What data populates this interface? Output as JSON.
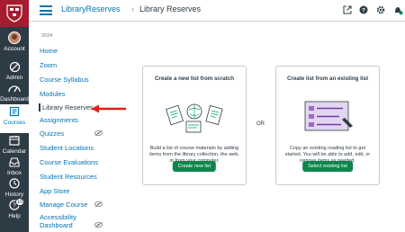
{
  "global_nav": {
    "items": [
      {
        "label": "Account",
        "icon": "avatar"
      },
      {
        "label": "Admin",
        "icon": "shield-icon"
      },
      {
        "label": "Dashboard",
        "icon": "dashboard-icon"
      },
      {
        "label": "Courses",
        "icon": "book-icon"
      },
      {
        "label": "Calendar",
        "icon": "calendar-icon"
      },
      {
        "label": "Inbox",
        "icon": "inbox-icon"
      },
      {
        "label": "History",
        "icon": "clock-icon"
      },
      {
        "label": "Help",
        "icon": "help-icon",
        "badge": "10"
      }
    ]
  },
  "header": {
    "breadcrumb_course": "LibraryReserves",
    "breadcrumb_separator": "›",
    "breadcrumb_page": "Library Reserves"
  },
  "course_nav": {
    "term": "2024",
    "items": [
      {
        "label": "Home"
      },
      {
        "label": "Zoom"
      },
      {
        "label": "Course Syllabus"
      },
      {
        "label": "Modules"
      },
      {
        "label": "Library Reserves"
      },
      {
        "label": "Assignments"
      },
      {
        "label": "Quizzes"
      },
      {
        "label": "Student Locations"
      },
      {
        "label": "Course Evaluations"
      },
      {
        "label": "Student Resources"
      },
      {
        "label": "App Store"
      },
      {
        "label": "Manage Course"
      },
      {
        "label": "Accessibility Dashboard"
      }
    ]
  },
  "main": {
    "card_new": {
      "title": "Create a new list from scratch",
      "description": "Build a list of course materials by adding items from the library collection, the web, or from your computer.",
      "button": "Create new list"
    },
    "or_label": "OR",
    "card_existing": {
      "title": "Create list from an existing list",
      "description": "Copy an existing reading list to get started. You will be able to add, edit, or remove items as needed.",
      "button": "Select existing list"
    }
  },
  "colors": {
    "nav_bg": "#2d3b45",
    "logo_bg": "#a51c30",
    "link": "#0374b5",
    "button_green": "#0b874b",
    "arrow_red": "#e0201b"
  }
}
